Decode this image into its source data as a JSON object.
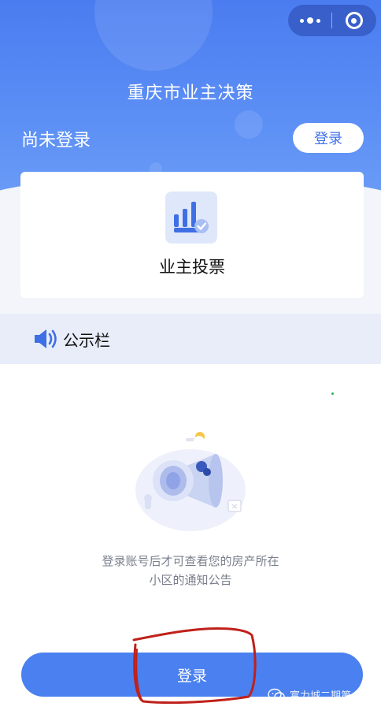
{
  "header": {
    "app_title": "重庆市业主决策",
    "login_status": "尚未登录",
    "login_button": "登录"
  },
  "capsule": {
    "more_icon": "more-dots-icon",
    "close_icon": "target-close-icon"
  },
  "feature_card": {
    "icon": "bar-chart-check-icon",
    "label": "业主投票"
  },
  "notice": {
    "icon": "speaker-icon",
    "title": "公示栏",
    "empty_illustration": "megaphone-illustration",
    "empty_text_line1": "登录账号后才可查看您的房产所在",
    "empty_text_line2": "小区的通知公告"
  },
  "bottom": {
    "login_button": "登录"
  },
  "watermark": {
    "icon": "wechat-icon",
    "text": "富力城二期第一区"
  },
  "colors": {
    "primary": "#4a80ef",
    "header_gradient_top": "#4a7cf0",
    "notice_bar_bg": "#e8edf9",
    "annotation_red": "#c0201a"
  }
}
